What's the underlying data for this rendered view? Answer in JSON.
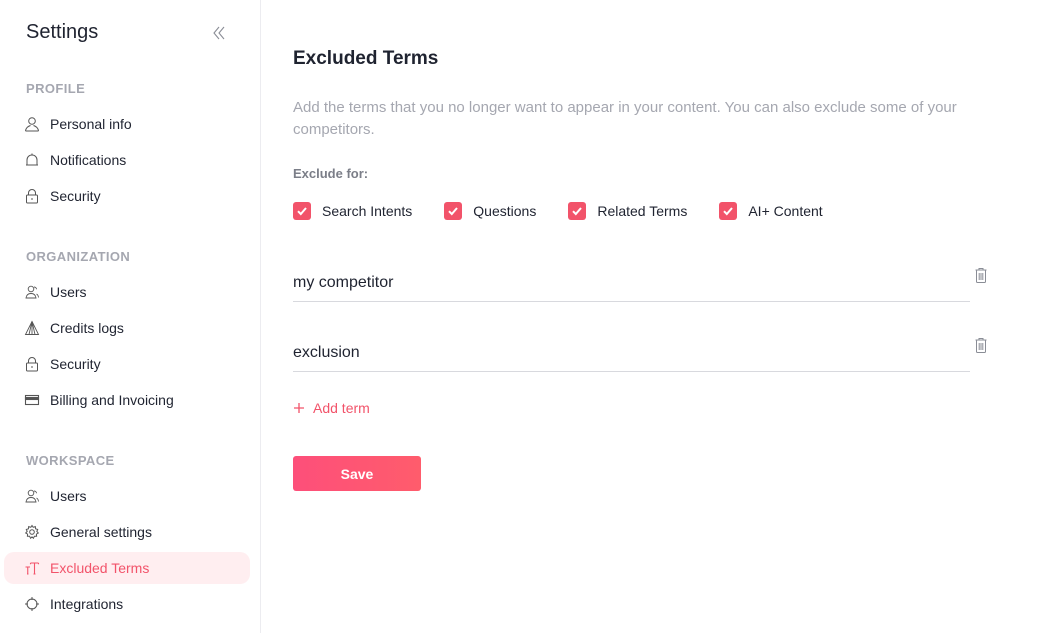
{
  "sidebar": {
    "title": "Settings",
    "collapse_icon": "double-chevron-left-icon",
    "sections": [
      {
        "label": "PROFILE",
        "items": [
          {
            "label": "Personal info",
            "icon": "user-icon"
          },
          {
            "label": "Notifications",
            "icon": "bell-icon"
          },
          {
            "label": "Security",
            "icon": "lock-icon"
          }
        ]
      },
      {
        "label": "ORGANIZATION",
        "items": [
          {
            "label": "Users",
            "icon": "users-icon"
          },
          {
            "label": "Credits logs",
            "icon": "pyramid-icon"
          },
          {
            "label": "Security",
            "icon": "lock-icon"
          },
          {
            "label": "Billing and Invoicing",
            "icon": "credit-card-icon"
          }
        ]
      },
      {
        "label": "WORKSPACE",
        "items": [
          {
            "label": "Users",
            "icon": "users-icon"
          },
          {
            "label": "General settings",
            "icon": "gear-icon"
          },
          {
            "label": "Excluded Terms",
            "icon": "text-size-icon",
            "active": true
          },
          {
            "label": "Integrations",
            "icon": "crosshair-icon"
          }
        ]
      }
    ]
  },
  "main": {
    "title": "Excluded Terms",
    "description": "Add the terms that you no longer want to appear in your content. You can also exclude some of your competitors.",
    "exclude_for_label": "Exclude for:",
    "checkboxes": [
      {
        "label": "Search Intents",
        "checked": true
      },
      {
        "label": "Questions",
        "checked": true
      },
      {
        "label": "Related Terms",
        "checked": true
      },
      {
        "label": "AI+ Content",
        "checked": true
      }
    ],
    "terms": [
      {
        "value": "my competitor"
      },
      {
        "value": "exclusion"
      }
    ],
    "add_term_label": "Add term",
    "save_label": "Save"
  },
  "colors": {
    "accent": "#f2536a",
    "active_bg": "#ffeef0",
    "muted_text": "#a5a7b0"
  }
}
